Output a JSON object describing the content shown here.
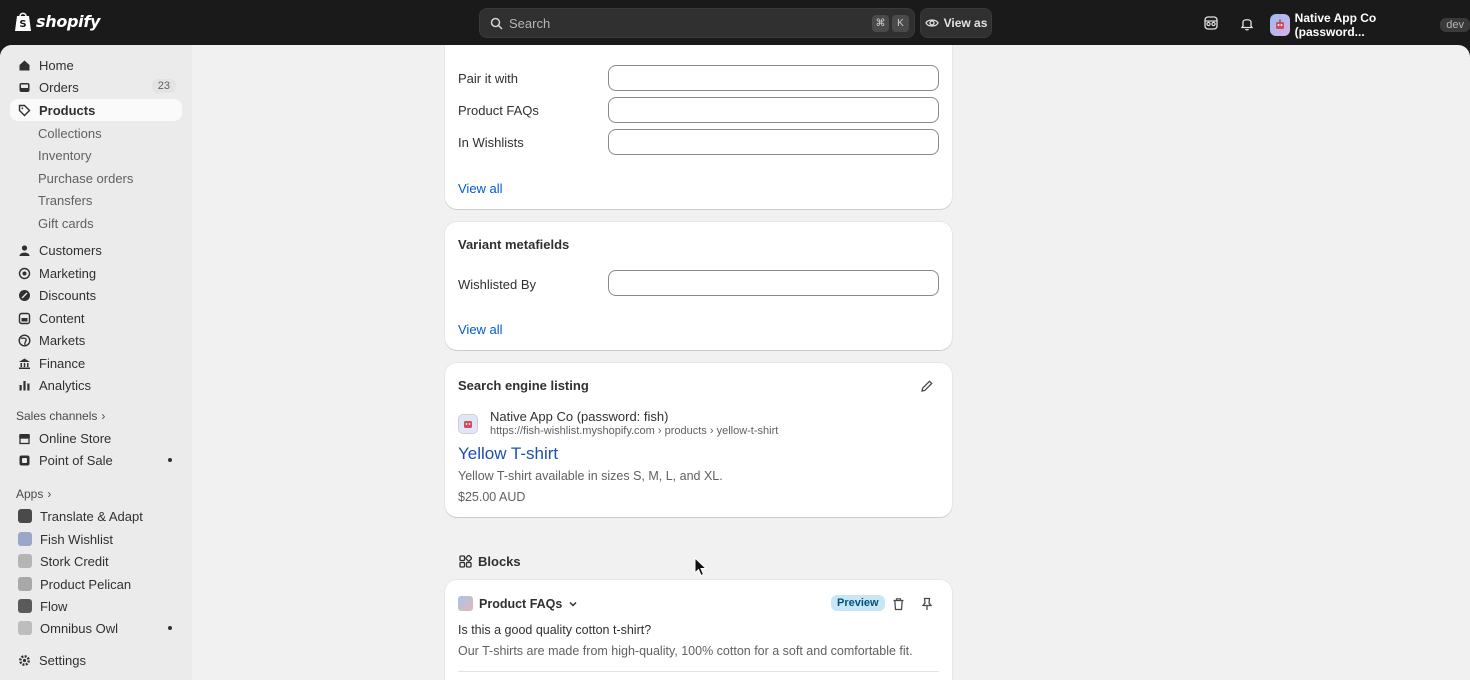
{
  "topbar": {
    "brand": "shopify",
    "search_placeholder": "Search",
    "shortcut_cmd": "⌘",
    "shortcut_key": "K",
    "view_as": "View as",
    "store_name": "Native App Co (password...",
    "store_badge": "dev"
  },
  "sidebar": {
    "home": "Home",
    "orders": "Orders",
    "orders_count": "23",
    "products": "Products",
    "collections": "Collections",
    "inventory": "Inventory",
    "purchase_orders": "Purchase orders",
    "transfers": "Transfers",
    "gift_cards": "Gift cards",
    "customers": "Customers",
    "marketing": "Marketing",
    "discounts": "Discounts",
    "content": "Content",
    "markets": "Markets",
    "finance": "Finance",
    "analytics": "Analytics",
    "sales_channels": "Sales channels",
    "online_store": "Online Store",
    "point_of_sale": "Point of Sale",
    "apps": "Apps",
    "app_translate": "Translate & Adapt",
    "app_fish": "Fish Wishlist",
    "app_stork": "Stork Credit",
    "app_pelican": "Product Pelican",
    "app_flow": "Flow",
    "app_omnibus": "Omnibus Owl",
    "settings": "Settings"
  },
  "product_metafields": {
    "fields": [
      "Pair it with",
      "Product FAQs",
      "In Wishlists"
    ],
    "view_all": "View all"
  },
  "variant_metafields": {
    "title": "Variant metafields",
    "field": "Wishlisted By",
    "view_all": "View all"
  },
  "seo": {
    "title": "Search engine listing",
    "store": "Native App Co (password: fish)",
    "url": "https://fish-wishlist.myshopify.com › products › yellow-t-shirt",
    "page_title": "Yellow T-shirt",
    "description": "Yellow T-shirt available in sizes S, M, L, and XL.",
    "price": "$25.00 AUD"
  },
  "blocks": {
    "heading": "Blocks",
    "app_name": "Product FAQs",
    "badge": "Preview",
    "question": "Is this a good quality cotton t-shirt?",
    "answer": "Our T-shirts are made from high-quality, 100% cotton for a soft and comfortable fit."
  }
}
